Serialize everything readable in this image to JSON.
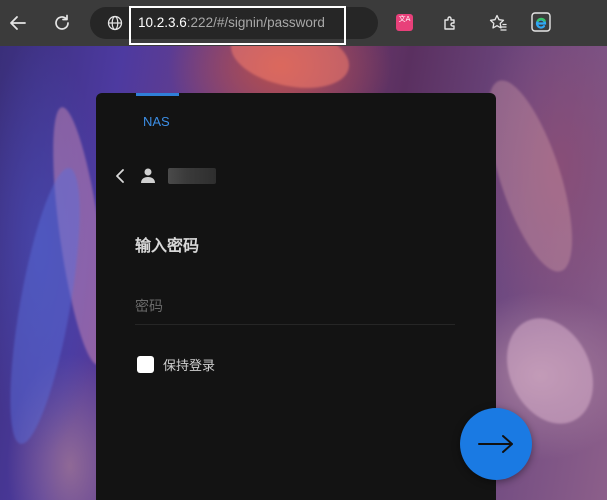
{
  "browser": {
    "url_host": "10.2.3.6",
    "url_rest": ":222/#/signin/password",
    "extension_badge": "文A"
  },
  "login": {
    "tab_label": "NAS",
    "title": "输入密码",
    "password_placeholder": "密码",
    "password_value": "",
    "remember_label": "保持登录",
    "remember_checked": false
  },
  "icons": {
    "toolbar": [
      "back-arrow-icon",
      "refresh-icon",
      "site-info-icon",
      "translate-extension-icon",
      "extensions-icon",
      "favorites-icon",
      "edge-icon"
    ],
    "card": [
      "chevron-left-icon",
      "user-icon",
      "arrow-right-icon"
    ]
  },
  "colors": {
    "accent": "#1a7ae3",
    "tab_accent": "#3c8ee5",
    "card_bg": "#131313",
    "toolbar_bg": "#3b3b3b"
  }
}
